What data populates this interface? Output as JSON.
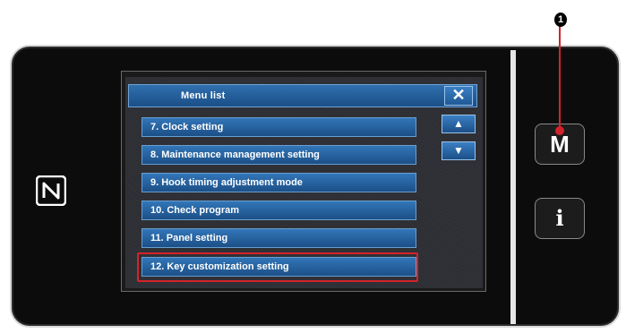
{
  "header": {
    "title": "Menu list",
    "close_label": "✕"
  },
  "scroll": {
    "up_label": "▲",
    "down_label": "▼"
  },
  "menu_items": [
    {
      "label": "7.   Clock setting"
    },
    {
      "label": "8.   Maintenance management setting"
    },
    {
      "label": "9.   Hook timing adjustment mode"
    },
    {
      "label": "10.  Check program"
    },
    {
      "label": "11.  Panel setting"
    },
    {
      "label": "12.  Key customization setting"
    }
  ],
  "side_buttons": {
    "m_label": "M",
    "info_label": "i"
  },
  "callout": {
    "number": "1"
  },
  "colors": {
    "accent": "#1c4f87",
    "highlight": "#d2232a"
  }
}
